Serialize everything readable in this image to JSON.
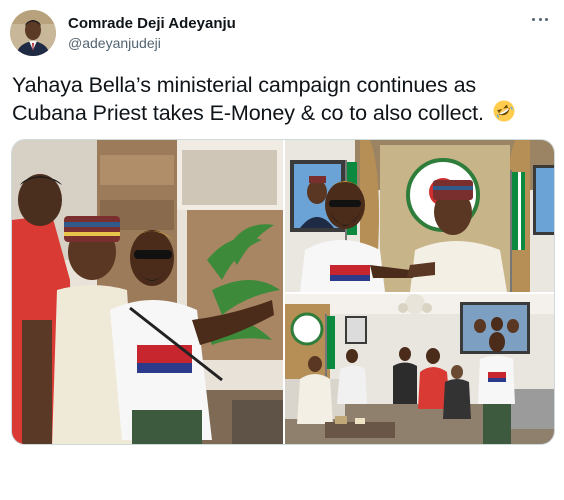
{
  "author": {
    "display_name": "Comrade Deji Adeyanju",
    "handle": "@adeyanjudeji"
  },
  "tweet": {
    "text": "Yahaya Bella’s ministerial campaign continues as Cubana Priest takes E-Money & co to also collect.",
    "emoji": "rolling-on-floor-laughing"
  },
  "media": [
    {
      "description_icon": "photo-group-outdoor"
    },
    {
      "description_icon": "photo-handshake-office"
    },
    {
      "description_icon": "photo-group-living-room"
    }
  ],
  "colors": {
    "text": "#0f1419",
    "secondary": "#536471",
    "border": "#cfd9de",
    "red_shirt": "#d93a33",
    "nigeria_green": "#0b8a3f"
  }
}
